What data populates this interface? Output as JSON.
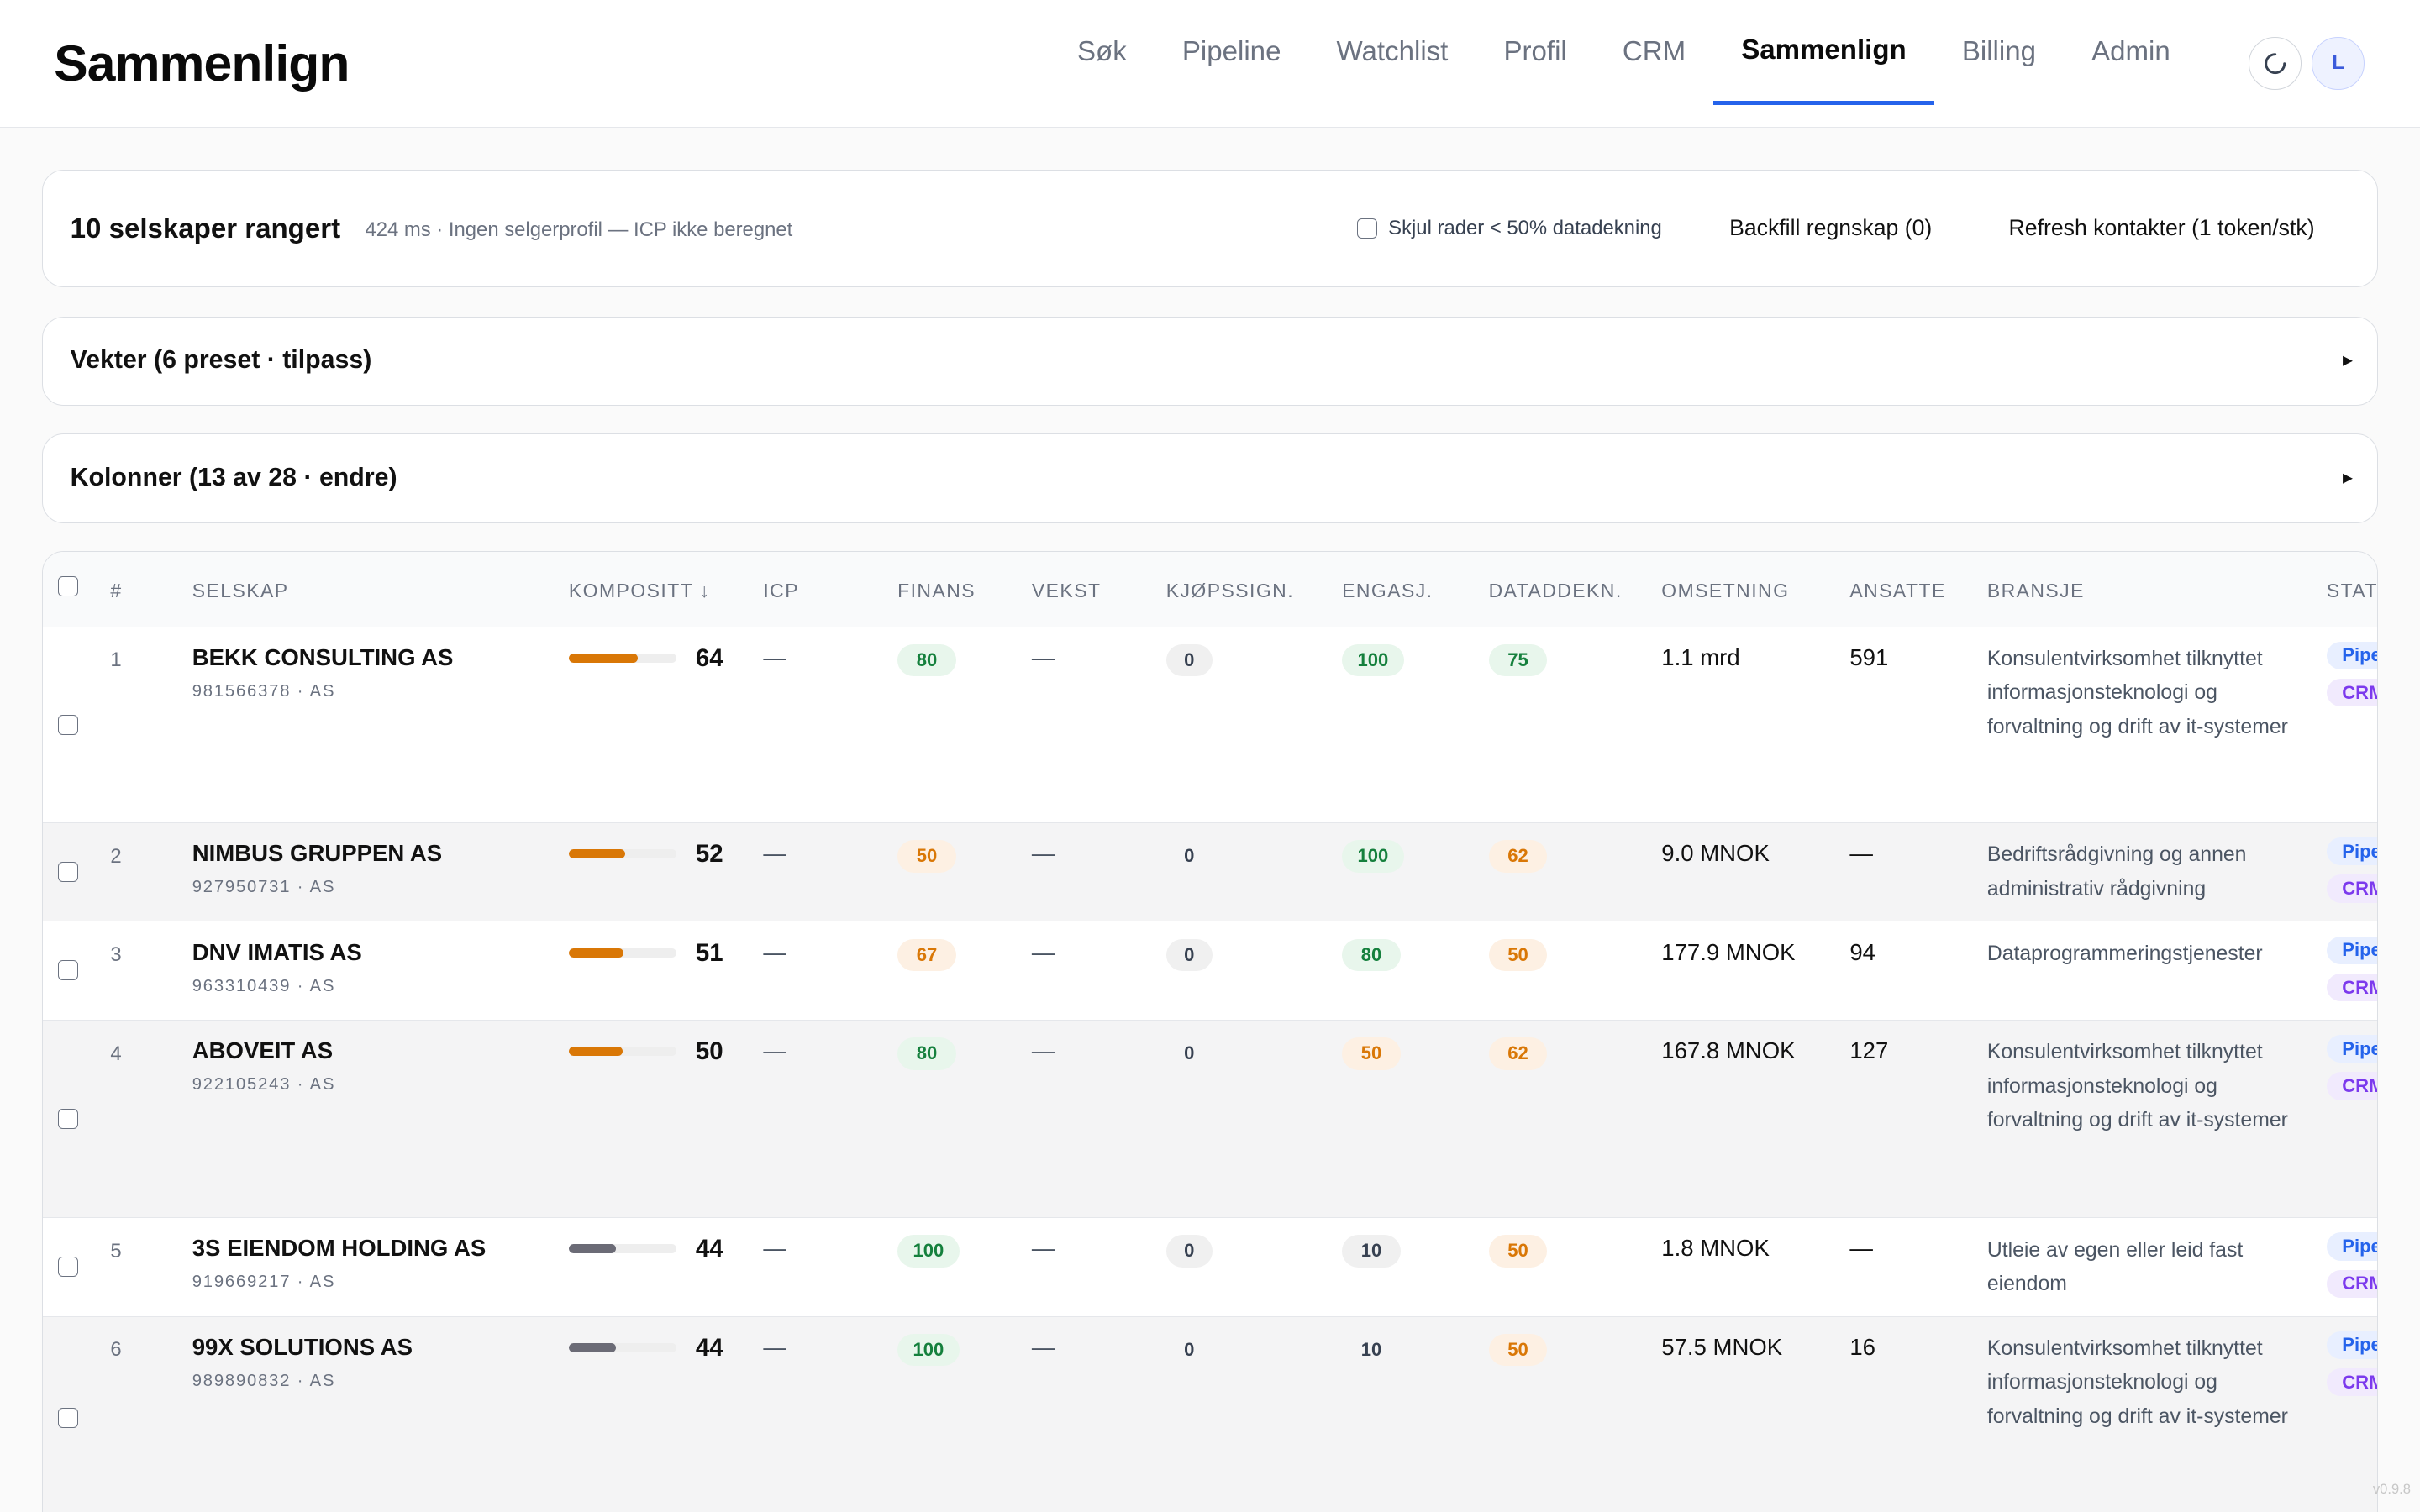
{
  "app": {
    "title": "Sammenlign",
    "version": "v0.9.8"
  },
  "nav": {
    "items": [
      "Søk",
      "Pipeline",
      "Watchlist",
      "Profil",
      "CRM",
      "Sammenlign",
      "Billing",
      "Admin"
    ],
    "active": "Sammenlign",
    "avatar_initial": "L"
  },
  "summary": {
    "title": "10 selskaper rangert",
    "meta": "424 ms · Ingen selgerprofil — ICP ikke beregnet",
    "hide_rows_label": "Skjul rader < 50% datadekning",
    "backfill_label": "Backfill regnskap (0)",
    "refresh_contacts_label": "Refresh kontakter (1 token/stk)"
  },
  "weights_panel": {
    "label": "Vekter (6 preset · tilpass)",
    "arrow": "▸"
  },
  "columns_panel": {
    "label": "Kolonner (13 av 28 · endre)",
    "arrow": "▸"
  },
  "table": {
    "headers": {
      "rank": "#",
      "company": "SELSKAP",
      "composite": "KOMPOSITT ↓",
      "icp": "ICP",
      "finance": "FINANS",
      "growth": "VEKST",
      "buy_signal": "KJØPSSIGN.",
      "engagement": "ENGASJ.",
      "data_coverage": "DATADDEKN.",
      "revenue": "OMSETNING",
      "employees": "ANSATTE",
      "industry": "BRANSJE",
      "status": "STATUS"
    },
    "rows": [
      {
        "rank": "1",
        "name": "BEKK CONSULTING AS",
        "sub": "981566378 · AS",
        "composite": 64,
        "composite_text": "64",
        "bar_color": "#d97706",
        "icp": "—",
        "finance": "80",
        "finance_tone": "green",
        "growth": "—",
        "buy_signal": "0",
        "buy_tone": "grey",
        "engagement": "100",
        "eng_tone": "green",
        "coverage": "75",
        "cov_tone": "green",
        "revenue": "1.1 mrd",
        "employees": "591",
        "industry": "Konsulentvirksomhet tilknyttet informasjonsteknologi og forvaltning og drift av it-systemer",
        "status": [
          "Pipe",
          "CRM"
        ]
      },
      {
        "rank": "2",
        "name": "NIMBUS GRUPPEN AS",
        "sub": "927950731 · AS",
        "composite": 52,
        "composite_text": "52",
        "bar_color": "#d97706",
        "icp": "—",
        "finance": "50",
        "finance_tone": "orange",
        "growth": "—",
        "buy_signal": "0",
        "buy_tone": "plain",
        "engagement": "100",
        "eng_tone": "green",
        "coverage": "62",
        "cov_tone": "orange",
        "revenue": "9.0 MNOK",
        "employees": "—",
        "industry": "Bedriftsrådgivning og annen administrativ rådgivning",
        "status": [
          "Pipe",
          "CRM"
        ]
      },
      {
        "rank": "3",
        "name": "DNV IMATIS AS",
        "sub": "963310439 · AS",
        "composite": 51,
        "composite_text": "51",
        "bar_color": "#d97706",
        "icp": "—",
        "finance": "67",
        "finance_tone": "orange",
        "growth": "—",
        "buy_signal": "0",
        "buy_tone": "grey",
        "engagement": "80",
        "eng_tone": "green",
        "coverage": "50",
        "cov_tone": "orange",
        "revenue": "177.9 MNOK",
        "employees": "94",
        "industry": "Dataprogrammeringstjenester",
        "status": [
          "Pipe",
          "CRM"
        ]
      },
      {
        "rank": "4",
        "name": "ABOVEIT AS",
        "sub": "922105243 · AS",
        "composite": 50,
        "composite_text": "50",
        "bar_color": "#d97706",
        "icp": "—",
        "finance": "80",
        "finance_tone": "green",
        "growth": "—",
        "buy_signal": "0",
        "buy_tone": "plain",
        "engagement": "50",
        "eng_tone": "orange",
        "coverage": "62",
        "cov_tone": "orange",
        "revenue": "167.8 MNOK",
        "employees": "127",
        "industry": "Konsulentvirksomhet tilknyttet informasjonsteknologi og forvaltning og drift av it-systemer",
        "status": [
          "Pipe",
          "CRM"
        ]
      },
      {
        "rank": "5",
        "name": "3S EIENDOM HOLDING AS",
        "sub": "919669217 · AS",
        "composite": 44,
        "composite_text": "44",
        "bar_color": "#6b6b76",
        "icp": "—",
        "finance": "100",
        "finance_tone": "green",
        "growth": "—",
        "buy_signal": "0",
        "buy_tone": "grey",
        "engagement": "10",
        "eng_tone": "grey",
        "coverage": "50",
        "cov_tone": "orange",
        "revenue": "1.8 MNOK",
        "employees": "—",
        "industry": "Utleie av egen eller leid fast eiendom",
        "status": [
          "Pipe",
          "CRM"
        ]
      },
      {
        "rank": "6",
        "name": "99X SOLUTIONS AS",
        "sub": "989890832 · AS",
        "composite": 44,
        "composite_text": "44",
        "bar_color": "#6b6b76",
        "icp": "—",
        "finance": "100",
        "finance_tone": "green",
        "growth": "—",
        "buy_signal": "0",
        "buy_tone": "plain",
        "engagement": "10",
        "eng_tone": "plain",
        "coverage": "50",
        "cov_tone": "orange",
        "revenue": "57.5 MNOK",
        "employees": "16",
        "industry": "Konsulentvirksomhet tilknyttet informasjonsteknologi og forvaltning og drift av it-systemer",
        "status": [
          "Pipe",
          "CRM"
        ]
      }
    ]
  }
}
